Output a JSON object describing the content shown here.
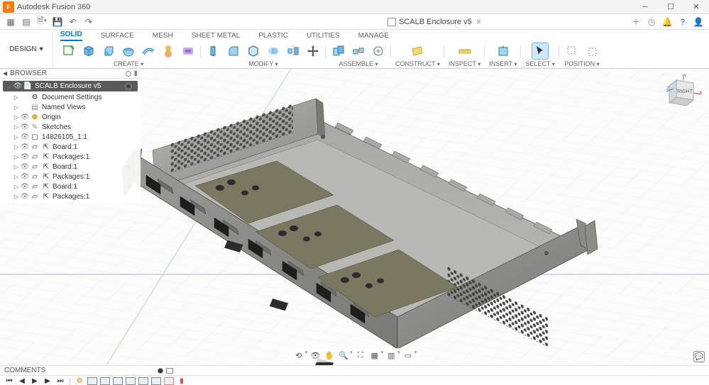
{
  "titlebar": {
    "app": "Autodesk Fusion 360",
    "icon_letter": "F"
  },
  "quickbar": {
    "doc_title": "SCALB Enclosure v5"
  },
  "ribbon": {
    "workspace": "DESIGN",
    "tabs": [
      "SOLID",
      "SURFACE",
      "MESH",
      "SHEET METAL",
      "PLASTIC",
      "UTILITIES",
      "MANAGE"
    ],
    "active_tab": 0,
    "groups": [
      {
        "label": "CREATE"
      },
      {
        "label": "MODIFY"
      },
      {
        "label": "ASSEMBLE"
      },
      {
        "label": "CONSTRUCT"
      },
      {
        "label": "INSPECT"
      },
      {
        "label": "INSERT"
      },
      {
        "label": "SELECT"
      },
      {
        "label": "POSITION"
      }
    ]
  },
  "browser": {
    "title": "BROWSER",
    "root": "SCALB Enclosure v5",
    "items": [
      {
        "label": "Document Settings",
        "icon": "doc"
      },
      {
        "label": "Named Views",
        "icon": "views"
      },
      {
        "label": "Origin",
        "icon": "origin"
      },
      {
        "label": "Sketches",
        "icon": "sketch"
      },
      {
        "label": "14826105_1:1",
        "icon": "comp"
      },
      {
        "label": "Board:1",
        "icon": "body"
      },
      {
        "label": "Packages:1",
        "icon": "body"
      },
      {
        "label": "Board:1",
        "icon": "body"
      },
      {
        "label": "Packages:1",
        "icon": "body"
      },
      {
        "label": "Board:1",
        "icon": "body"
      },
      {
        "label": "Packages:1",
        "icon": "body"
      }
    ]
  },
  "comments": {
    "title": "COMMENTS"
  },
  "viewcube": {
    "face_right": "RIGHT",
    "axes": {
      "x": "X",
      "y": "Y",
      "z": "Z"
    }
  }
}
